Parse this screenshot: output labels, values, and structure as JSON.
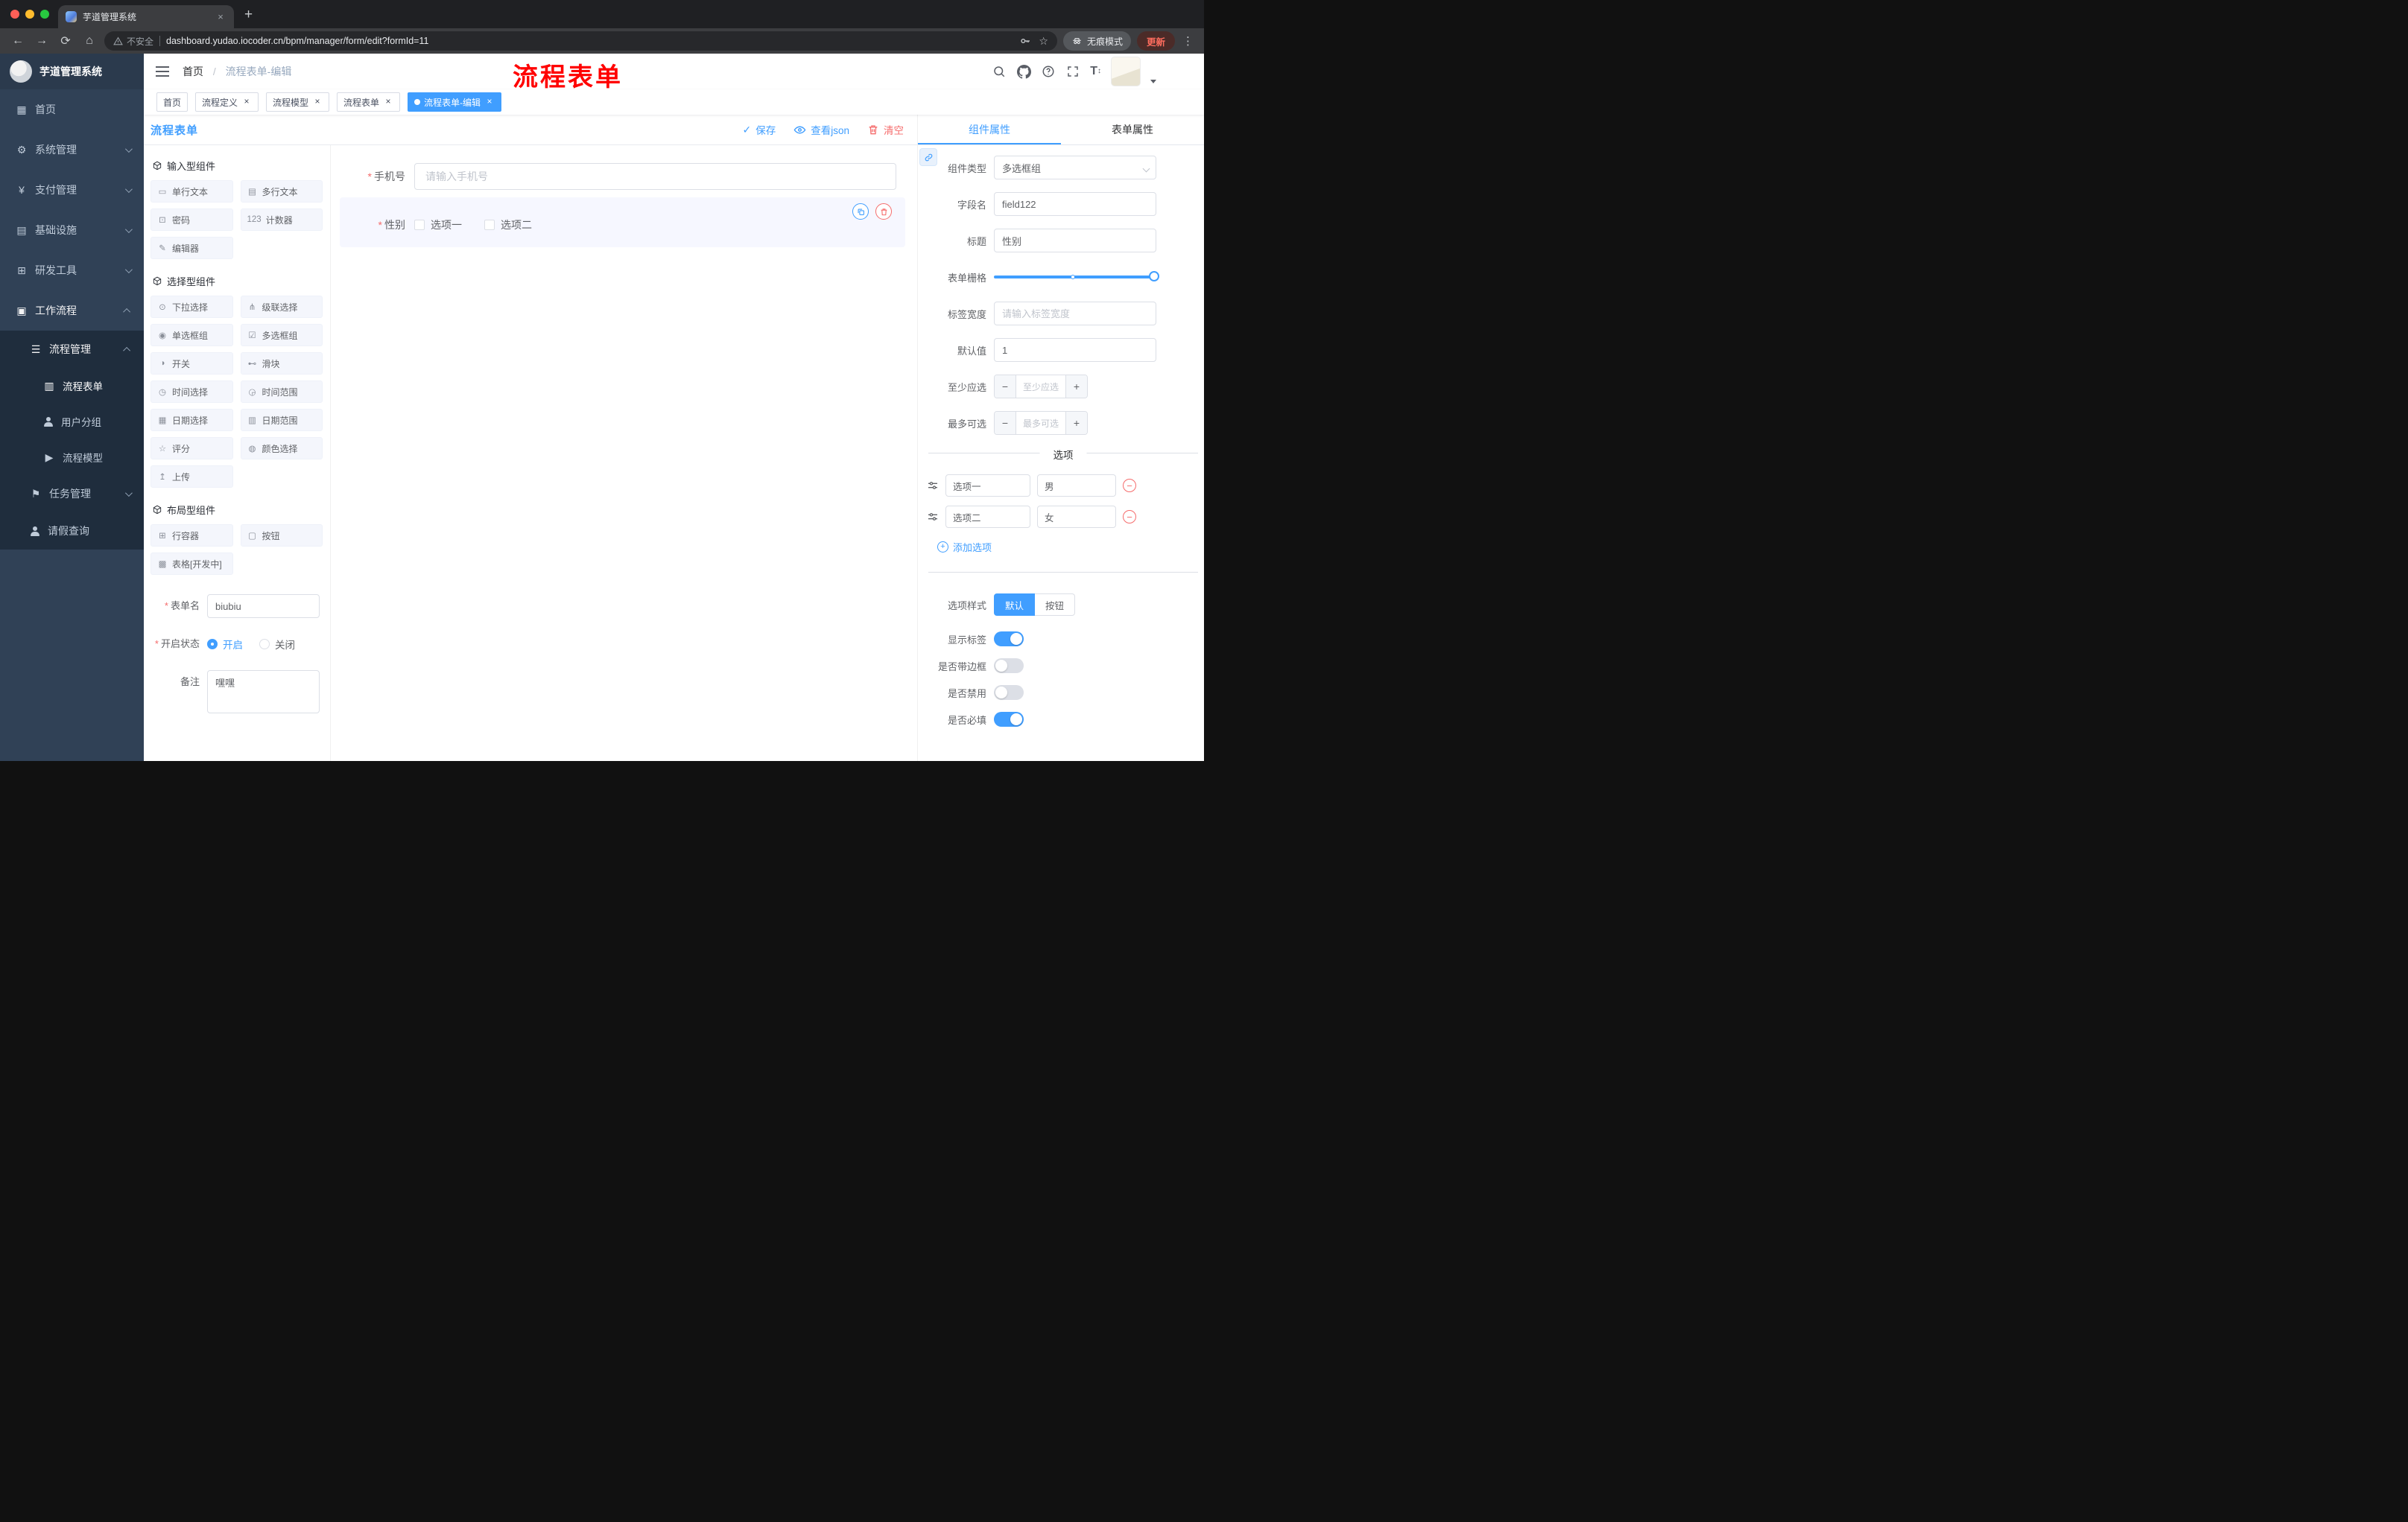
{
  "colors": {
    "primary": "#409EFF",
    "danger": "#F56C6C",
    "annotation": "#FF0000",
    "sidebar_bg": "#304156",
    "submenu_bg": "#1F2D3D"
  },
  "browser": {
    "tab": {
      "title": "芋道管理系统"
    },
    "toolbar": {
      "security_label": "不安全",
      "url": "dashboard.yudao.iocoder.cn/bpm/manager/form/edit?formId=11",
      "incognito_label": "无痕模式",
      "update_label": "更新"
    }
  },
  "sidebar": {
    "title": "芋道管理系统",
    "menu": [
      {
        "label": "首页",
        "icon": "▦"
      },
      {
        "label": "系统管理",
        "icon": "⚙"
      },
      {
        "label": "支付管理",
        "icon": "¥"
      },
      {
        "label": "基础设施",
        "icon": "▤"
      },
      {
        "label": "研发工具",
        "icon": "⊞"
      },
      {
        "label": "工作流程",
        "icon": "▣"
      }
    ],
    "sub": {
      "process": {
        "label": "流程管理",
        "icon": "☰"
      },
      "children": [
        {
          "label": "流程表单",
          "icon": "▥"
        },
        {
          "label": "用户分组",
          "icon": ""
        },
        {
          "label": "流程模型",
          "icon": "▶"
        }
      ],
      "task": {
        "label": "任务管理",
        "icon": "⚑"
      },
      "leave": {
        "label": "请假查询",
        "icon": ""
      }
    }
  },
  "header": {
    "breadcrumb": {
      "home": "首页",
      "current": "流程表单-编辑"
    },
    "annotation": "流程表单"
  },
  "tags": [
    {
      "label": "首页",
      "active": false
    },
    {
      "label": "流程定义",
      "active": false
    },
    {
      "label": "流程模型",
      "active": false
    },
    {
      "label": "流程表单",
      "active": false
    },
    {
      "label": "流程表单-编辑",
      "active": true
    }
  ],
  "designer": {
    "title": "流程表单",
    "actions": {
      "save": "保存",
      "view_json": "查看json",
      "clear": "清空"
    }
  },
  "components": {
    "groups": [
      {
        "title": "输入型组件",
        "items": [
          {
            "label": "单行文本",
            "icon": "▭"
          },
          {
            "label": "多行文本",
            "icon": "▤"
          },
          {
            "label": "密码",
            "icon": "⊡"
          },
          {
            "label": "计数器",
            "icon": "123"
          },
          {
            "label": "编辑器",
            "icon": "✎"
          }
        ]
      },
      {
        "title": "选择型组件",
        "items": [
          {
            "label": "下拉选择",
            "icon": "⊙"
          },
          {
            "label": "级联选择",
            "icon": "⋔"
          },
          {
            "label": "单选框组",
            "icon": "◉"
          },
          {
            "label": "多选框组",
            "icon": "☑"
          },
          {
            "label": "开关",
            "icon": "◑"
          },
          {
            "label": "滑块",
            "icon": "⊷"
          },
          {
            "label": "时间选择",
            "icon": "◷"
          },
          {
            "label": "时间范围",
            "icon": "◶"
          },
          {
            "label": "日期选择",
            "icon": "▦"
          },
          {
            "label": "日期范围",
            "icon": "▥"
          },
          {
            "label": "评分",
            "icon": "☆"
          },
          {
            "label": "颜色选择",
            "icon": "◍"
          },
          {
            "label": "上传",
            "icon": "↥"
          }
        ]
      },
      {
        "title": "布局型组件",
        "items": [
          {
            "label": "行容器",
            "icon": "⊞"
          },
          {
            "label": "按钮",
            "icon": "▢"
          },
          {
            "label": "表格[开发中]",
            "icon": "▩"
          }
        ]
      }
    ],
    "meta": {
      "form_name_label": "表单名",
      "form_name_value": "biubiu",
      "status_label": "开启状态",
      "status_on": "开启",
      "status_on_checked": true,
      "status_off": "关闭",
      "remark_label": "备注",
      "remark_value": "嘿嘿"
    }
  },
  "canvas": {
    "phone": {
      "label": "手机号",
      "placeholder": "请输入手机号"
    },
    "gender": {
      "label": "性别",
      "options": [
        "选项一",
        "选项二"
      ]
    }
  },
  "props": {
    "tabs": {
      "component": "组件属性",
      "form": "表单属性"
    },
    "fields": {
      "type_label": "组件类型",
      "type_value": "多选框组",
      "field_label": "字段名",
      "field_value": "field122",
      "title_label": "标题",
      "title_value": "性别",
      "grid_label": "表单栅格",
      "grid_value": 24,
      "grid_max": 24,
      "label_width_label": "标签宽度",
      "label_width_placeholder": "请输入标签宽度",
      "default_label": "默认值",
      "default_value": "1",
      "min_label": "至少应选",
      "min_placeholder": "至少应选",
      "max_label": "最多可选",
      "max_placeholder": "最多可选"
    },
    "options": {
      "divider_label": "选项",
      "rows": [
        {
          "name": "选项一",
          "value": "男"
        },
        {
          "name": "选项二",
          "value": "女"
        }
      ],
      "add_label": "添加选项"
    },
    "style": {
      "label": "选项样式",
      "default_btn": "默认",
      "button_btn": "按钮"
    },
    "switches": [
      {
        "label": "显示标签",
        "on": true
      },
      {
        "label": "是否带边框",
        "on": false
      },
      {
        "label": "是否禁用",
        "on": false
      },
      {
        "label": "是否必填",
        "on": true
      }
    ]
  }
}
